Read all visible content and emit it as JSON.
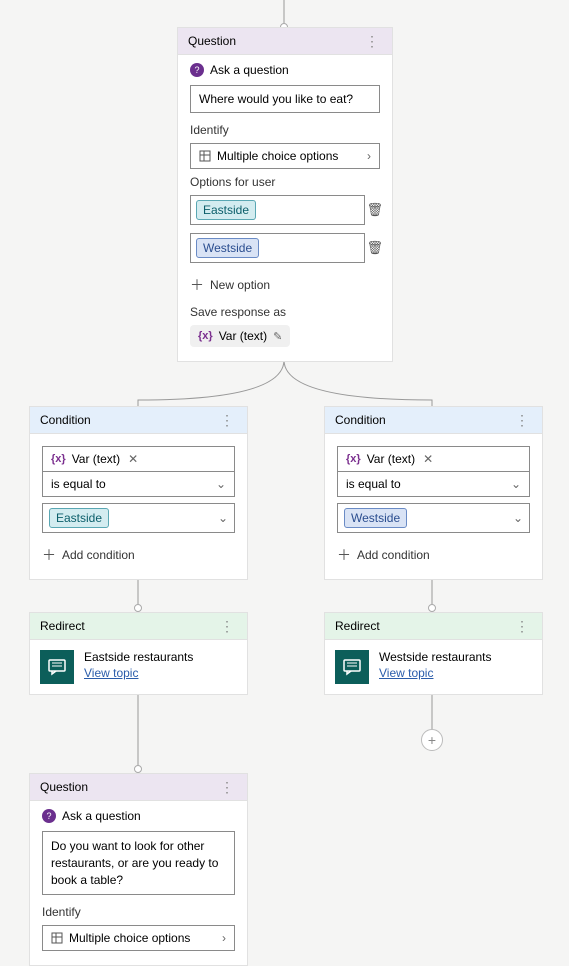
{
  "question1": {
    "header": "Question",
    "ask_label": "Ask a question",
    "prompt": "Where would you like to eat?",
    "identify_label": "Identify",
    "identify_value": "Multiple choice options",
    "options_label": "Options for user",
    "option1": "Eastside",
    "option2": "Westside",
    "new_option": "New option",
    "save_label": "Save response as",
    "var_text": "Var (text)"
  },
  "condition1": {
    "header": "Condition",
    "var_text": "Var (text)",
    "operator": "is equal to",
    "value": "Eastside",
    "add": "Add condition"
  },
  "condition2": {
    "header": "Condition",
    "var_text": "Var (text)",
    "operator": "is equal to",
    "value": "Westside",
    "add": "Add condition"
  },
  "redirect1": {
    "header": "Redirect",
    "title": "Eastside restaurants",
    "link": "View topic"
  },
  "redirect2": {
    "header": "Redirect",
    "title": "Westside restaurants",
    "link": "View topic"
  },
  "question2": {
    "header": "Question",
    "ask_label": "Ask a question",
    "prompt": "Do you want to look for other restaurants, or are you ready to book a table?",
    "identify_label": "Identify",
    "identify_value": "Multiple choice options"
  }
}
